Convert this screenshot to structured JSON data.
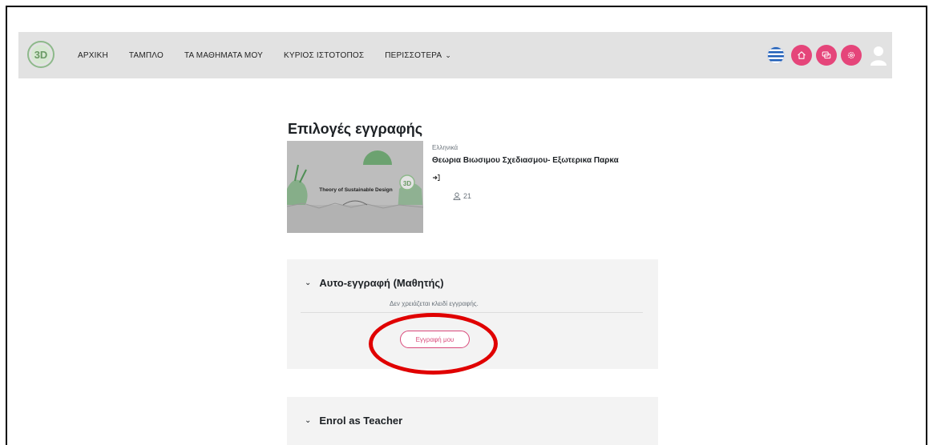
{
  "navbar": {
    "logo_text": "3D",
    "items": [
      {
        "label": "ΑΡΧΙΚΗ"
      },
      {
        "label": "ΤΑΜΠΛΟ"
      },
      {
        "label": "ΤΑ ΜΑΘΗΜΑΤΑ ΜΟΥ"
      },
      {
        "label": "ΚΥΡΙΟΣ ΙΣΤΟΤΟΠΟΣ"
      },
      {
        "label": "ΠΕΡΙΣΣΟΤΕΡΑ"
      }
    ],
    "more_chevron": "⌄",
    "right_icons": [
      "greek-flag-icon",
      "home-icon",
      "messages-icon",
      "settings-icon",
      "user-avatar-icon"
    ],
    "accent_color": "#e5457a"
  },
  "page": {
    "title": "Επιλογές εγγραφής"
  },
  "course": {
    "image_text": "Theory of Sustainable Design",
    "image_logo_text": "3D",
    "language": "Ελληνικά",
    "name": "Θεωρια Βιωσιμου Σχεδιασμου- Εξωτερικα Παρκα",
    "participants_count": "21"
  },
  "enrolment_methods": [
    {
      "title": "Αυτο-εγγραφή (Μαθητής)",
      "note": "Δεν χρειάζεται κλειδί εγγραφής.",
      "button_label": "Εγγραφή μου"
    },
    {
      "title": "Enrol as Teacher"
    }
  ],
  "annotation": {
    "color": "#e00000",
    "target": "Εγγραφή μου"
  }
}
